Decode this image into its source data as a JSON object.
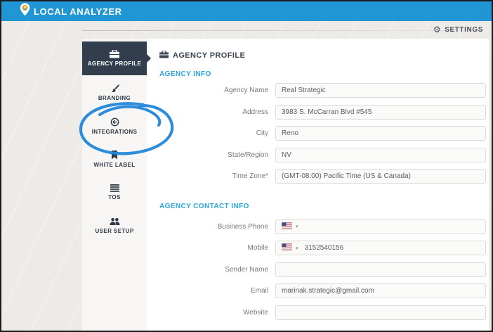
{
  "header": {
    "brand": "LOCAL ANALYZER"
  },
  "settings_bar": {
    "label": "SETTINGS",
    "icon": "gear-icon"
  },
  "sidebar": {
    "items": [
      {
        "id": "agency-profile",
        "label": "AGENCY PROFILE",
        "icon": "briefcase",
        "active": true
      },
      {
        "id": "branding",
        "label": "BRANDING",
        "icon": "paintbrush",
        "active": false
      },
      {
        "id": "integrations",
        "label": "INTEGRATIONS",
        "icon": "integrations-target",
        "active": false
      },
      {
        "id": "white-label",
        "label": "WHITE LABEL",
        "icon": "bookmark",
        "active": false
      },
      {
        "id": "tos",
        "label": "TOS",
        "icon": "list",
        "active": false
      },
      {
        "id": "user-setup",
        "label": "USER SETUP",
        "icon": "users",
        "active": false
      }
    ]
  },
  "main": {
    "title": "AGENCY PROFILE",
    "title_icon": "briefcase-icon",
    "sections": [
      {
        "heading": "AGENCY INFO",
        "fields": [
          {
            "label": "Agency Name",
            "value": "Real Strategic",
            "type": "text"
          },
          {
            "label": "Address",
            "value": "3983 S. McCarran Blvd #545",
            "type": "text"
          },
          {
            "label": "City",
            "value": "Reno",
            "type": "text"
          },
          {
            "label": "State/Region",
            "value": "NV",
            "type": "text"
          },
          {
            "label": "Time Zone*",
            "value": "(GMT-08:00) Pacific Time (US & Canada)",
            "type": "text"
          }
        ]
      },
      {
        "heading": "AGENCY CONTACT INFO",
        "fields": [
          {
            "label": "Business Phone",
            "value": "",
            "type": "phone",
            "flag": "us-flag-icon"
          },
          {
            "label": "Mobile",
            "value": "3152540156",
            "type": "phone",
            "flag": "us-flag-icon"
          },
          {
            "label": "Sender Name",
            "value": "",
            "type": "text"
          },
          {
            "label": "Email",
            "value": "marinak.strategic@gmail.com",
            "type": "text"
          },
          {
            "label": "Website",
            "value": "",
            "type": "text"
          }
        ]
      }
    ]
  },
  "annotation": {
    "shape": "hand-drawn-circle",
    "target": "integrations",
    "color": "#2387d9"
  },
  "colors": {
    "header_blue": "#2196d4",
    "active_item_dark": "#323e4d",
    "section_heading_blue": "#2aa6dd",
    "annotation_blue": "#2387d9",
    "canvas_gray": "#edebe7"
  }
}
